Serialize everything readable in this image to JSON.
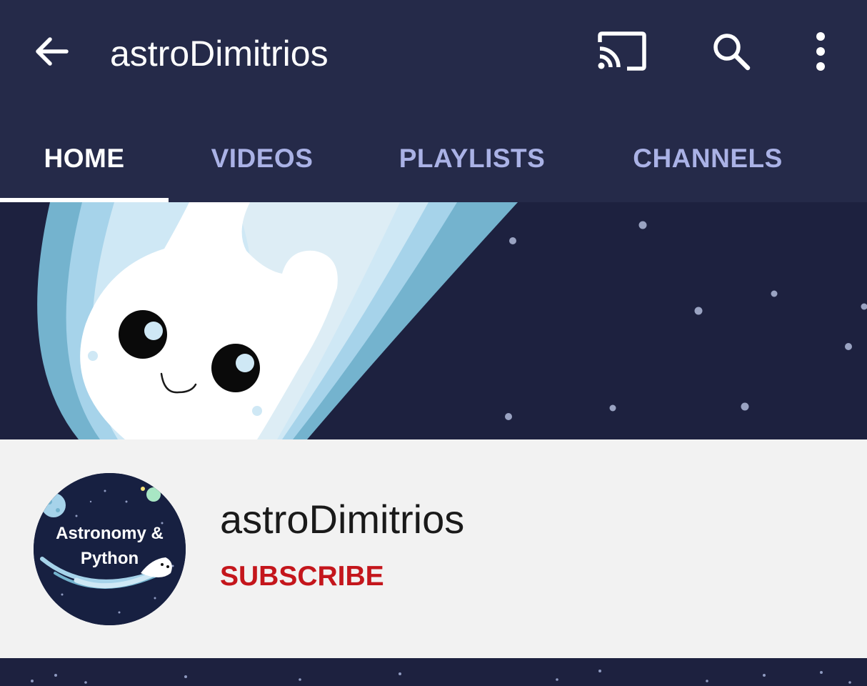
{
  "app_bar": {
    "title": "astroDimitrios",
    "icons": [
      "back-arrow-icon",
      "cast-icon",
      "search-icon",
      "more-vert-icon"
    ]
  },
  "tabs": [
    {
      "label": "HOME",
      "active": true
    },
    {
      "label": "VIDEOS",
      "active": false
    },
    {
      "label": "PLAYLISTS",
      "active": false
    },
    {
      "label": "CHANNELS",
      "active": false
    }
  ],
  "channel": {
    "name": "astroDimitrios",
    "subscribe_label": "SUBSCRIBE",
    "avatar_text_line1": "Astronomy &",
    "avatar_text_line2": "Python"
  },
  "colors": {
    "app_bar_bg": "#252a49",
    "banner_bg": "#1d213f",
    "tab_inactive": "#aab2e6",
    "subscribe": "#c4161c"
  }
}
